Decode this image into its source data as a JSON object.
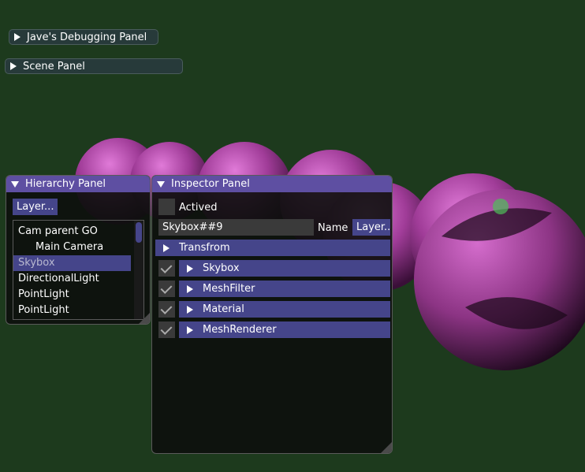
{
  "panels": {
    "debug_title": "Jave's Debugging Panel",
    "scene_title": "Scene Panel"
  },
  "hierarchy": {
    "title": "Hierarchy Panel",
    "layer_button": "Layer...",
    "items": [
      "Cam parent GO",
      "Main Camera",
      "Skybox",
      "DirectionalLight",
      "PointLight",
      "PointLight"
    ]
  },
  "inspector": {
    "title": "Inspector Panel",
    "actived_label": "Actived",
    "name_value": "Skybox##9",
    "name_label": "Name",
    "layer_button": "Layer...",
    "transform_header": "Transfrom",
    "components": [
      "Skybox",
      "MeshFilter",
      "Material",
      "MeshRenderer"
    ]
  },
  "colors": {
    "background": "#1d3a1d",
    "title_bar": "#5e4fa2",
    "header": "#45458a",
    "sphere": "#c04ab4"
  }
}
